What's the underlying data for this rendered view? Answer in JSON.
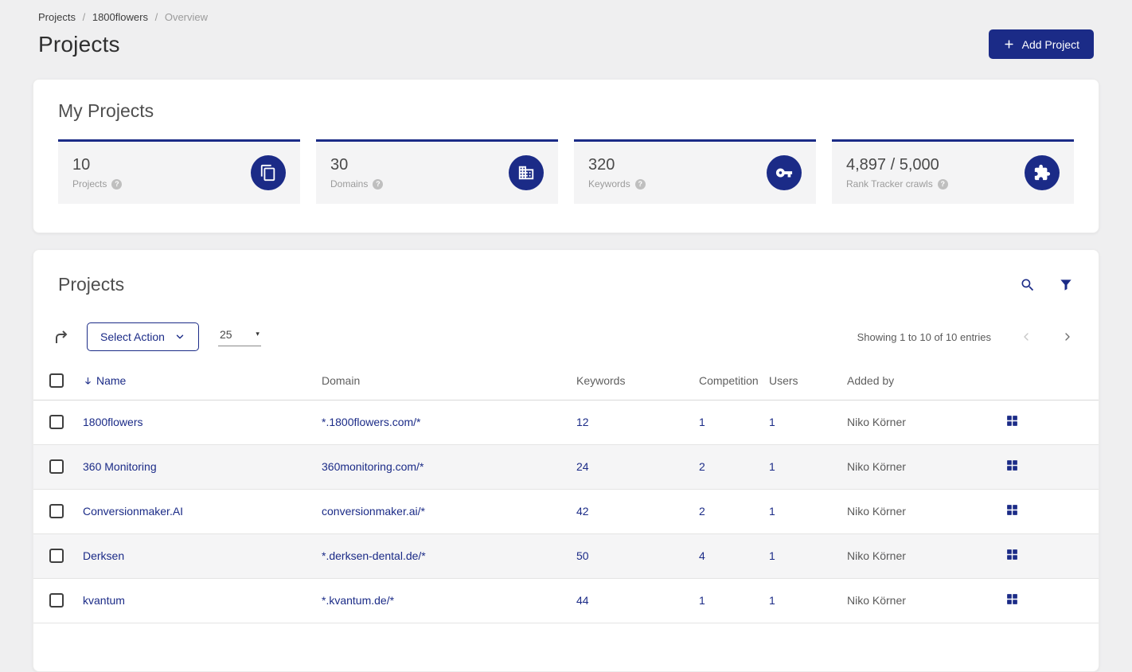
{
  "breadcrumb": {
    "items": [
      "Projects",
      "1800flowers",
      "Overview"
    ],
    "separator": "/"
  },
  "page": {
    "title": "Projects"
  },
  "header": {
    "add_project_label": "Add Project"
  },
  "my_projects": {
    "title": "My Projects",
    "stats": [
      {
        "value": "10",
        "label": "Projects",
        "icon": "copy-icon"
      },
      {
        "value": "30",
        "label": "Domains",
        "icon": "building-icon"
      },
      {
        "value": "320",
        "label": "Keywords",
        "icon": "key-icon"
      },
      {
        "value": "4,897 / 5,000",
        "label": "Rank Tracker crawls",
        "icon": "puzzle-icon"
      }
    ]
  },
  "projects_table": {
    "title": "Projects",
    "select_action_label": "Select Action",
    "page_size": "25",
    "showing_text": "Showing 1 to 10 of 10 entries",
    "columns": [
      "Name",
      "Domain",
      "Keywords",
      "Competition",
      "Users",
      "Added by"
    ],
    "rows": [
      {
        "name": "1800flowers",
        "domain": "*.1800flowers.com/*",
        "keywords": "12",
        "competition": "1",
        "users": "1",
        "added_by": "Niko Körner"
      },
      {
        "name": "360 Monitoring",
        "domain": "360monitoring.com/*",
        "keywords": "24",
        "competition": "2",
        "users": "1",
        "added_by": "Niko Körner"
      },
      {
        "name": "Conversionmaker.AI",
        "domain": "conversionmaker.ai/*",
        "keywords": "42",
        "competition": "2",
        "users": "1",
        "added_by": "Niko Körner"
      },
      {
        "name": "Derksen",
        "domain": "*.derksen-dental.de/*",
        "keywords": "50",
        "competition": "4",
        "users": "1",
        "added_by": "Niko Körner"
      },
      {
        "name": "kvantum",
        "domain": "*.kvantum.de/*",
        "keywords": "44",
        "competition": "1",
        "users": "1",
        "added_by": "Niko Körner"
      }
    ]
  },
  "icons": {
    "add_project": "plus-icon",
    "stats": [
      "copy-icon",
      "building-icon",
      "key-icon",
      "puzzle-icon"
    ],
    "help": "question-mark-icon",
    "card_head": [
      "search-icon",
      "filter-icon"
    ],
    "toolbar": [
      "export-arrow-icon",
      "chevron-down-icon",
      "caret-down-icon"
    ],
    "sort": "arrow-down-icon",
    "pagination": [
      "chevron-left-icon",
      "chevron-right-icon"
    ],
    "row_action": "dashboard-grid-icon"
  },
  "colors": {
    "navy": "#1b2b87",
    "background": "#efeff0",
    "row_alt": "#f5f5f6"
  }
}
